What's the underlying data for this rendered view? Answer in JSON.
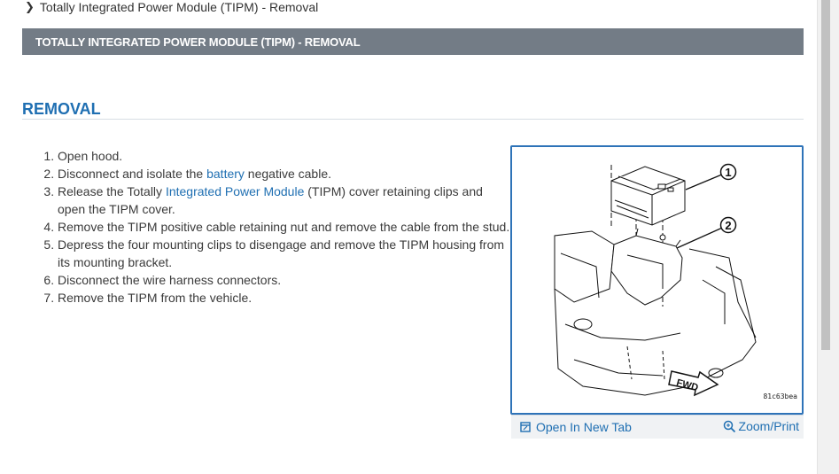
{
  "breadcrumb": {
    "text": "Totally Integrated Power Module (TIPM) - Removal"
  },
  "section_title": "TOTALLY INTEGRATED POWER MODULE (TIPM) - REMOVAL",
  "heading": "REMOVAL",
  "steps": {
    "s1": "Open hood.",
    "s2_pre": "Disconnect and isolate the ",
    "s2_link": "battery",
    "s2_post": " negative cable.",
    "s3_pre": "Release the Totally ",
    "s3_link": "Integrated Power Module",
    "s3_post": " (TIPM) cover retaining clips and open the TIPM cover.",
    "s4": "Remove the TIPM positive cable retaining nut and remove the cable from the stud.",
    "s5": "Depress the four mounting clips to disengage and remove the TIPM housing from its mounting bracket.",
    "s6": "Disconnect the wire harness connectors.",
    "s7": "Remove the TIPM from the vehicle."
  },
  "figure": {
    "callout_1": "1",
    "callout_2": "2",
    "fwd_label": "FWD",
    "code": "81c63bea"
  },
  "figure_toolbar": {
    "open_label": "Open In New Tab",
    "zoom_label": "Zoom/Print"
  },
  "colors": {
    "link": "#1f6fb2",
    "section_bar": "#737c86",
    "figure_border": "#2e73b8"
  },
  "icons": {
    "breadcrumb": "chevron-right-icon",
    "open": "open-new-tab-icon",
    "zoom": "magnifier-icon"
  }
}
